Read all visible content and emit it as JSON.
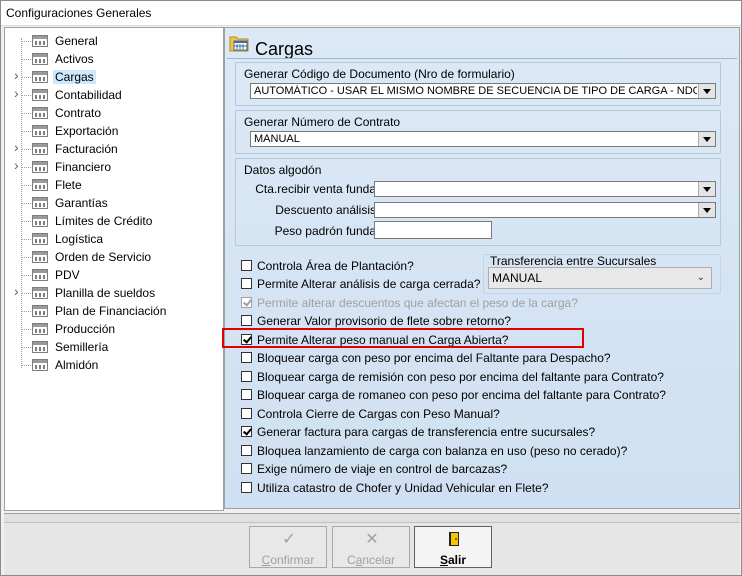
{
  "window": {
    "title": "Configuraciones Generales"
  },
  "tree": {
    "items": [
      {
        "label": "General",
        "expandable": false,
        "selected": false
      },
      {
        "label": "Activos",
        "expandable": false,
        "selected": false
      },
      {
        "label": "Cargas",
        "expandable": true,
        "selected": true
      },
      {
        "label": "Contabilidad",
        "expandable": true,
        "selected": false
      },
      {
        "label": "Contrato",
        "expandable": false,
        "selected": false
      },
      {
        "label": "Exportación",
        "expandable": false,
        "selected": false
      },
      {
        "label": "Facturación",
        "expandable": true,
        "selected": false
      },
      {
        "label": "Financiero",
        "expandable": true,
        "selected": false
      },
      {
        "label": "Flete",
        "expandable": false,
        "selected": false
      },
      {
        "label": "Garantías",
        "expandable": false,
        "selected": false
      },
      {
        "label": "Límites de Crédito",
        "expandable": false,
        "selected": false
      },
      {
        "label": "Logística",
        "expandable": false,
        "selected": false
      },
      {
        "label": "Orden de Servicio",
        "expandable": false,
        "selected": false
      },
      {
        "label": "PDV",
        "expandable": false,
        "selected": false
      },
      {
        "label": "Planilla de sueldos",
        "expandable": true,
        "selected": false
      },
      {
        "label": "Plan de Financiación",
        "expandable": false,
        "selected": false
      },
      {
        "label": "Producción",
        "expandable": false,
        "selected": false
      },
      {
        "label": "Semillería",
        "expandable": false,
        "selected": false
      },
      {
        "label": "Almidón",
        "expandable": false,
        "selected": false
      }
    ]
  },
  "panel": {
    "title": "Cargas",
    "codigo": {
      "label": "Generar Código de Documento (Nro de formulario)",
      "value": "AUTOMÁTICO - USAR EL MISMO NOMBRE DE SECUENCIA DE TIPO DE CARGA - NDOGECARGA"
    },
    "contrato": {
      "label": "Generar Número de Contrato",
      "value": "MANUAL"
    },
    "algodon": {
      "title": "Datos algodón",
      "cta_label": "Cta.recibir venta funda",
      "cta_value": "",
      "descuento_label": "Descuento análisis",
      "descuento_value": "",
      "peso_label": "Peso padrón funda",
      "peso_value": ""
    },
    "transferencia": {
      "label": "Transferencia entre Sucursales",
      "value": "MANUAL"
    },
    "checks": [
      {
        "label": "Controla Área de Plantación?",
        "checked": false,
        "disabled": false
      },
      {
        "label": "Permite Alterar análisis de carga cerrada?",
        "checked": false,
        "disabled": false
      },
      {
        "label": "Permite alterar descuentos que afectan el peso de la carga?",
        "checked": true,
        "disabled": true
      },
      {
        "label": "Generar Valor provisorio de flete sobre retorno?",
        "checked": false,
        "disabled": false
      },
      {
        "label": "Permite Alterar peso manual en Carga Abierta?",
        "checked": true,
        "disabled": false
      },
      {
        "label": "Bloquear carga con peso por encima del Faltante para Despacho?",
        "checked": false,
        "disabled": false
      },
      {
        "label": "Bloquear carga de remisión con peso por encima del faltante para Contrato?",
        "checked": false,
        "disabled": false
      },
      {
        "label": "Bloquear carga de romaneo con peso por encima del faltante para Contrato?",
        "checked": false,
        "disabled": false
      },
      {
        "label": "Controla Cierre de Cargas con Peso Manual?",
        "checked": false,
        "disabled": false
      },
      {
        "label": "Generar factura para cargas de transferencia entre sucursales?",
        "checked": true,
        "disabled": false
      },
      {
        "label": "Bloquea lanzamiento de carga con balanza en uso (peso no cerado)?",
        "checked": false,
        "disabled": false
      },
      {
        "label": "Exige número de viaje en control de barcazas?",
        "checked": false,
        "disabled": false
      },
      {
        "label": "Utiliza catastro de Chofer y Unidad Vehicular en Flete?",
        "checked": false,
        "disabled": false
      }
    ]
  },
  "footer": {
    "confirmar": {
      "label": "Confirmar",
      "icon": "check-icon",
      "enabled": false
    },
    "cancelar": {
      "label": "Cancelar",
      "icon": "cross-icon",
      "enabled": false
    },
    "salir": {
      "label": "Salir",
      "icon": "exit-door-icon",
      "enabled": true
    }
  },
  "colors": {
    "highlight": "#e00000",
    "selected": "#cce8ff",
    "panel_bg": "#d6e5f5"
  }
}
